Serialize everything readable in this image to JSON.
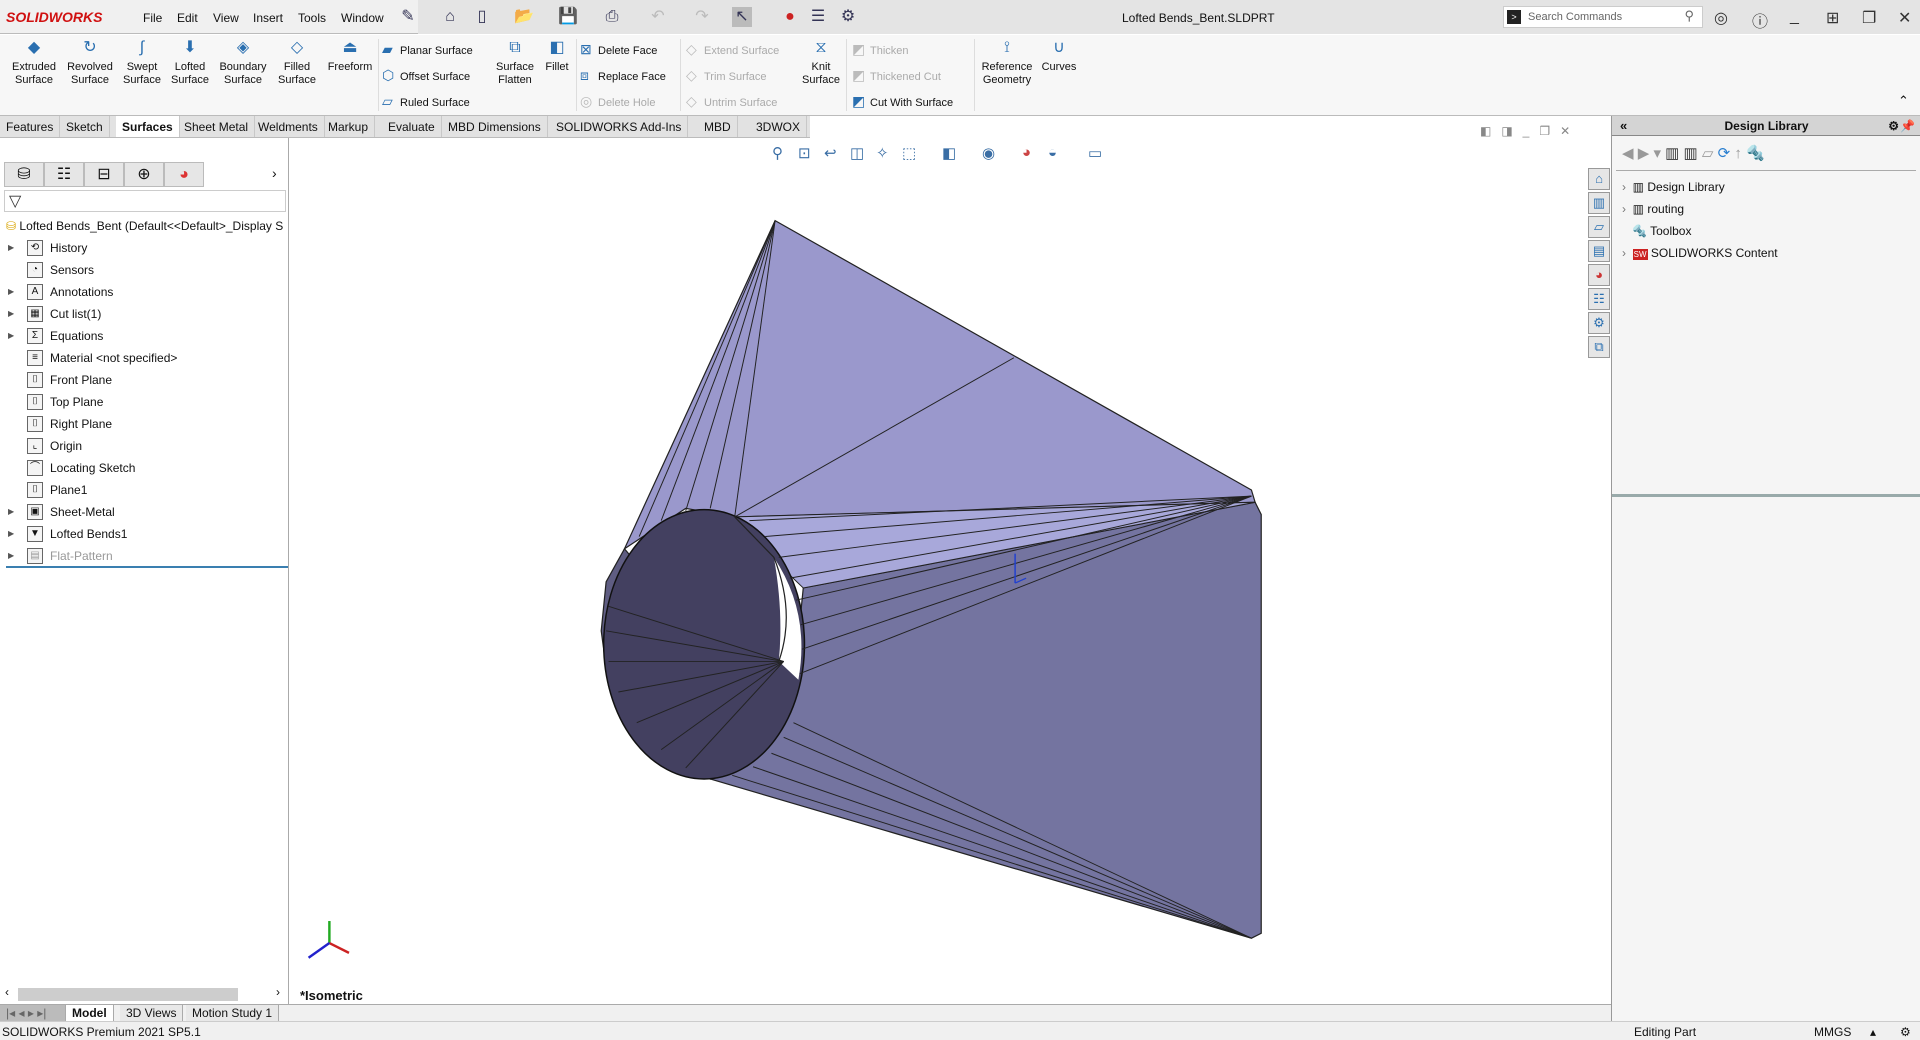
{
  "app": {
    "logo": "SOLIDWORKS",
    "document_title": "Lofted Bends_Bent.SLDPRT",
    "search_placeholder": "Search Commands"
  },
  "menu": [
    "File",
    "Edit",
    "View",
    "Insert",
    "Tools",
    "Window"
  ],
  "ribbon": {
    "large_buttons": [
      [
        "Extruded",
        "Surface"
      ],
      [
        "Revolved",
        "Surface"
      ],
      [
        "Swept",
        "Surface"
      ],
      [
        "Lofted",
        "Surface"
      ],
      [
        "Boundary",
        "Surface"
      ],
      [
        "Filled",
        "Surface"
      ],
      [
        "Freeform",
        ""
      ]
    ],
    "small_col1": [
      "Planar Surface",
      "Offset Surface",
      "Ruled Surface"
    ],
    "surface_flatten": [
      "Surface",
      "Flatten"
    ],
    "fillet": "Fillet",
    "small_col2": [
      "Delete Face",
      "Replace Face",
      "Delete Hole"
    ],
    "small_col3": [
      "Extend Surface",
      "Trim Surface",
      "Untrim Surface"
    ],
    "knit": [
      "Knit",
      "Surface"
    ],
    "small_col4": [
      "Thicken",
      "Thickened Cut",
      "Cut With Surface"
    ],
    "reference_geometry": [
      "Reference",
      "Geometry"
    ],
    "curves": "Curves"
  },
  "tabs": [
    "Features",
    "Sketch",
    "Surfaces",
    "Sheet Metal",
    "Weldments",
    "Markup",
    "Evaluate",
    "MBD Dimensions",
    "SOLIDWORKS Add-Ins",
    "MBD",
    "3DWOX"
  ],
  "active_tab": "Surfaces",
  "tree": {
    "root": "Lofted Bends_Bent  (Default<<Default>_Display S",
    "items": [
      {
        "label": "History",
        "expand": true
      },
      {
        "label": "Sensors",
        "expand": false
      },
      {
        "label": "Annotations",
        "expand": true
      },
      {
        "label": "Cut list(1)",
        "expand": true
      },
      {
        "label": "Equations",
        "expand": true
      },
      {
        "label": "Material <not specified>",
        "expand": false
      },
      {
        "label": "Front Plane",
        "expand": false
      },
      {
        "label": "Top Plane",
        "expand": false
      },
      {
        "label": "Right Plane",
        "expand": false
      },
      {
        "label": "Origin",
        "expand": false
      },
      {
        "label": "Locating Sketch",
        "expand": false
      },
      {
        "label": "Plane1",
        "expand": false
      },
      {
        "label": "Sheet-Metal",
        "expand": true
      },
      {
        "label": "Lofted Bends1",
        "expand": true
      },
      {
        "label": "Flat-Pattern",
        "expand": true,
        "suppressed": true
      }
    ]
  },
  "viewport": {
    "view_name": "*Isometric",
    "face_color": "#9a98cc"
  },
  "bottom_tabs": [
    "Model",
    "3D Views",
    "Motion Study 1"
  ],
  "status": {
    "version": "SOLIDWORKS Premium 2021 SP5.1",
    "mode": "Editing Part",
    "units": "MMGS"
  },
  "design_library": {
    "title": "Design Library",
    "items": [
      {
        "label": "Design Library",
        "expand": true
      },
      {
        "label": "routing",
        "expand": true
      },
      {
        "label": "Toolbox",
        "expand": false
      },
      {
        "label": "SOLIDWORKS Content",
        "expand": true
      }
    ]
  }
}
